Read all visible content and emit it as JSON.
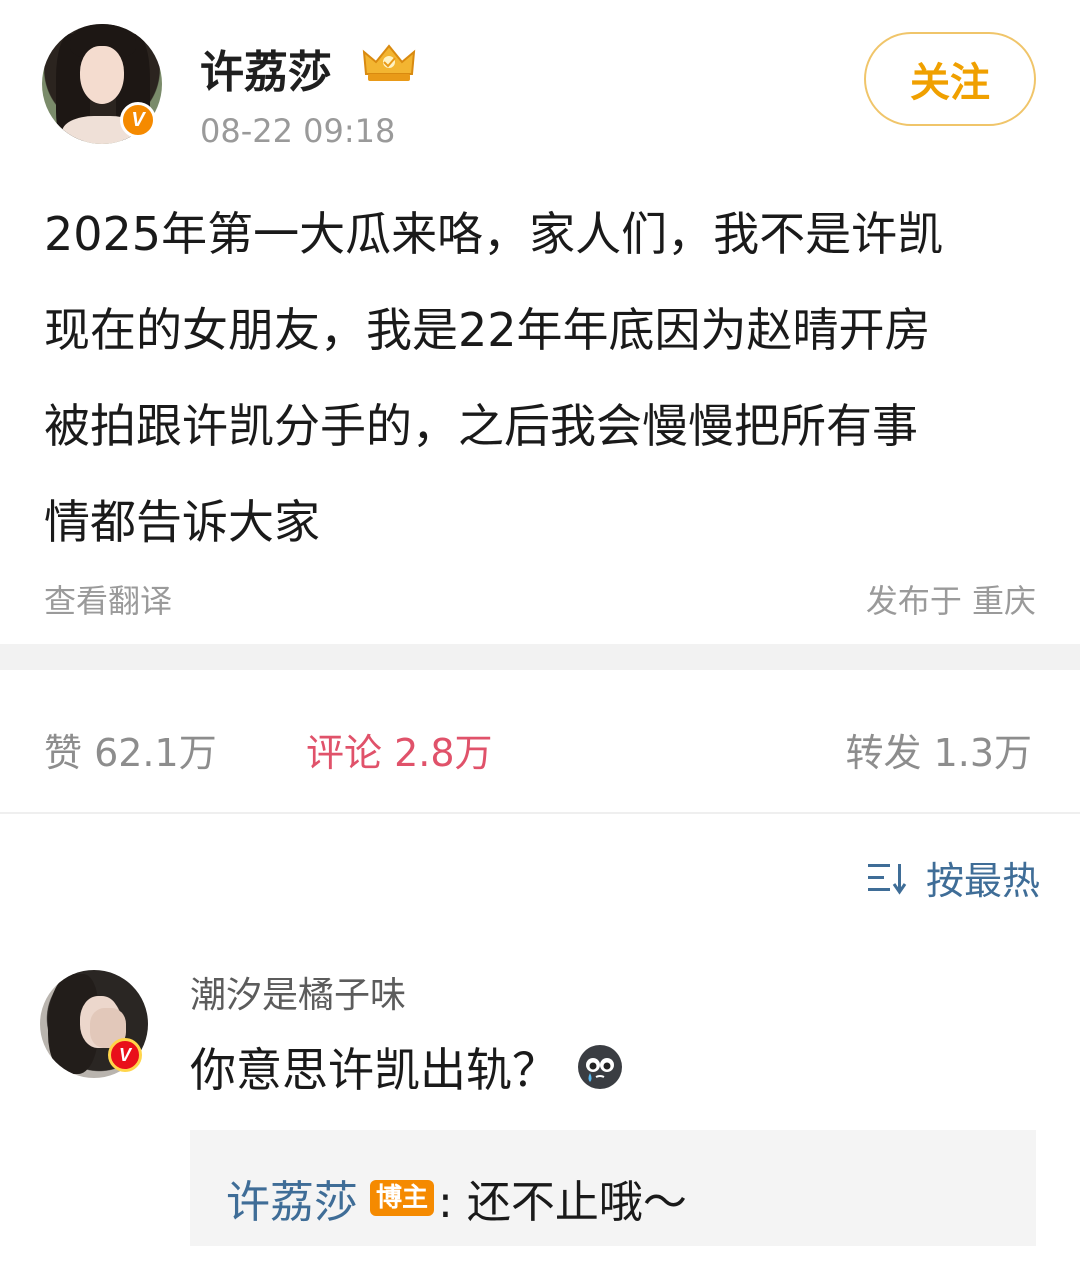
{
  "post": {
    "author": "许荔莎",
    "time": "08-22 09:18",
    "follow_label": "关注",
    "body_lines": [
      "2025年第一大瓜来咯，家人们，我不是许凯",
      "现在的女朋友，我是22年年底因为赵晴开房",
      "被拍跟许凯分手的，之后我会慢慢把所有事",
      "情都告诉大家"
    ],
    "translate_label": "查看翻译",
    "location": "发布于 重庆",
    "verified_badge": "V"
  },
  "stats": {
    "likes": "赞 62.1万",
    "comments": "评论 2.8万",
    "reposts": "转发 1.3万"
  },
  "sort": {
    "label": "按最热",
    "icon": "sort-icon"
  },
  "comment": {
    "user": "潮汐是橘子味",
    "text": "你意思许凯出轨？",
    "emoji": "crying-face-icon",
    "verified_badge": "V",
    "reply": {
      "author": "许荔莎",
      "tag": "博主",
      "text": ": 还不止哦～"
    }
  },
  "colors": {
    "follow_border": "#f0c56a",
    "follow_text": "#f0a000",
    "comment_stat": "#e0526a",
    "link_blue": "#3f6d97",
    "badge_orange": "#f58a00"
  }
}
